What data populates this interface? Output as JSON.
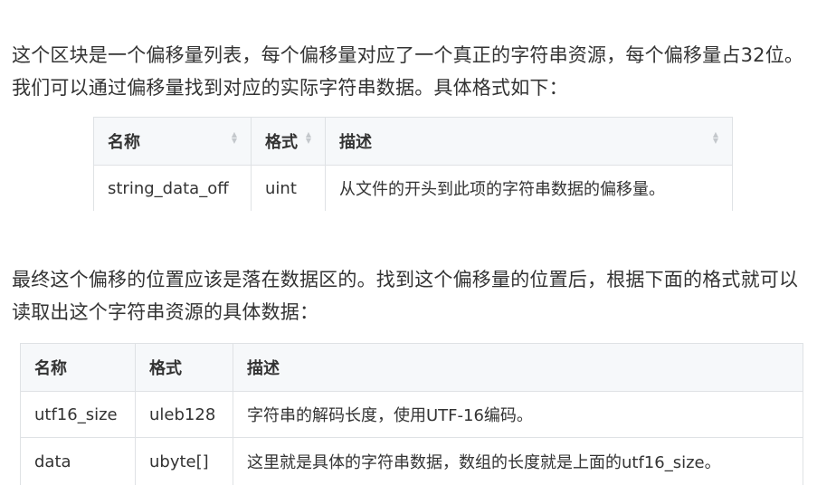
{
  "intro": "这个区块是一个偏移量列表，每个偏移量对应了一个真正的字符串资源，每个偏移量占32位。我们可以通过偏移量找到对应的实际字符串数据。具体格式如下：",
  "table1": {
    "headers": [
      "名称",
      "格式",
      "描述"
    ],
    "rows": [
      [
        "string_data_off",
        "uint",
        "从文件的开头到此项的字符串数据的偏移量。"
      ]
    ]
  },
  "outro": "最终这个偏移的位置应该是落在数据区的。找到这个偏移量的位置后，根据下面的格式就可以读取出这个字符串资源的具体数据：",
  "table2": {
    "headers": [
      "名称",
      "格式",
      "描述"
    ],
    "rows": [
      [
        "utf16_size",
        "uleb128",
        "字符串的解码长度，使用UTF-16编码。"
      ],
      [
        "data",
        "ubyte[]",
        "这里就是具体的字符串数据，数组的长度就是上面的utf16_size。"
      ]
    ]
  }
}
